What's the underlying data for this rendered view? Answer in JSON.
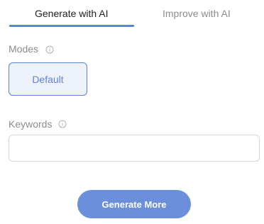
{
  "tabs": {
    "active_label": "Generate with AI",
    "inactive_label": "Improve with AI"
  },
  "modes": {
    "label": "Modes",
    "info_icon": "info-icon",
    "selected_option": "Default"
  },
  "keywords": {
    "label": "Keywords",
    "info_icon": "info-icon",
    "value": "",
    "placeholder": ""
  },
  "actions": {
    "generate_label": "Generate More"
  },
  "colors": {
    "accent": "#5b83d6",
    "button_fill": "#6b8fdb",
    "mode_fill": "#eef2fb",
    "muted_text": "#8c8c8c"
  }
}
